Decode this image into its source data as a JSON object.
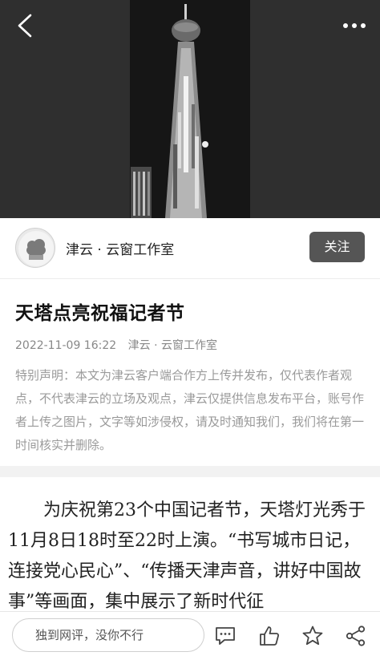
{
  "header": {
    "back_icon": "chevron-left-icon",
    "more_icon": "more-dots-icon"
  },
  "author": {
    "name": "津云 · 云窗工作室",
    "follow_label": "关注"
  },
  "article": {
    "title": "天塔点亮祝福记者节",
    "date": "2022-11-09 16:22",
    "source": "津云 · 云窗工作室",
    "disclaimer": "特别声明：本文为津云客户端合作方上传并发布，仅代表作者观点，不代表津云的立场及观点，津云仅提供信息发布平台，账号作者上传之图片，文字等如涉侵权，请及时通知我们，我们将在第一时间核实并删除。",
    "body": "为庆祝第23个中国记者节，天塔灯光秀于11月8日18时至22时上演。“书写城市日记，连接党心民心”、“传播天津声音，讲好中国故事”等画面，集中展示了新时代征"
  },
  "bottom_bar": {
    "comment_placeholder": "独到网评，没你不行",
    "icons": [
      "comment-icon",
      "thumbs-up-icon",
      "star-icon",
      "share-icon"
    ]
  }
}
